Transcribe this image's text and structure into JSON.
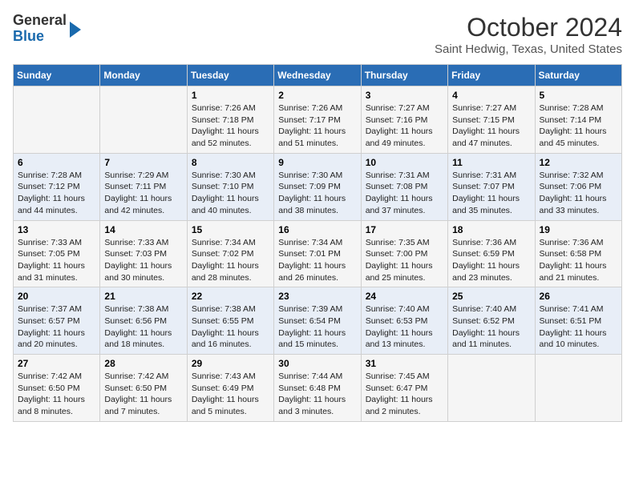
{
  "header": {
    "logo_line1": "General",
    "logo_line2": "Blue",
    "title": "October 2024",
    "subtitle": "Saint Hedwig, Texas, United States"
  },
  "days_of_week": [
    "Sunday",
    "Monday",
    "Tuesday",
    "Wednesday",
    "Thursday",
    "Friday",
    "Saturday"
  ],
  "weeks": [
    [
      {
        "num": "",
        "info": ""
      },
      {
        "num": "",
        "info": ""
      },
      {
        "num": "1",
        "info": "Sunrise: 7:26 AM\nSunset: 7:18 PM\nDaylight: 11 hours and 52 minutes."
      },
      {
        "num": "2",
        "info": "Sunrise: 7:26 AM\nSunset: 7:17 PM\nDaylight: 11 hours and 51 minutes."
      },
      {
        "num": "3",
        "info": "Sunrise: 7:27 AM\nSunset: 7:16 PM\nDaylight: 11 hours and 49 minutes."
      },
      {
        "num": "4",
        "info": "Sunrise: 7:27 AM\nSunset: 7:15 PM\nDaylight: 11 hours and 47 minutes."
      },
      {
        "num": "5",
        "info": "Sunrise: 7:28 AM\nSunset: 7:14 PM\nDaylight: 11 hours and 45 minutes."
      }
    ],
    [
      {
        "num": "6",
        "info": "Sunrise: 7:28 AM\nSunset: 7:12 PM\nDaylight: 11 hours and 44 minutes."
      },
      {
        "num": "7",
        "info": "Sunrise: 7:29 AM\nSunset: 7:11 PM\nDaylight: 11 hours and 42 minutes."
      },
      {
        "num": "8",
        "info": "Sunrise: 7:30 AM\nSunset: 7:10 PM\nDaylight: 11 hours and 40 minutes."
      },
      {
        "num": "9",
        "info": "Sunrise: 7:30 AM\nSunset: 7:09 PM\nDaylight: 11 hours and 38 minutes."
      },
      {
        "num": "10",
        "info": "Sunrise: 7:31 AM\nSunset: 7:08 PM\nDaylight: 11 hours and 37 minutes."
      },
      {
        "num": "11",
        "info": "Sunrise: 7:31 AM\nSunset: 7:07 PM\nDaylight: 11 hours and 35 minutes."
      },
      {
        "num": "12",
        "info": "Sunrise: 7:32 AM\nSunset: 7:06 PM\nDaylight: 11 hours and 33 minutes."
      }
    ],
    [
      {
        "num": "13",
        "info": "Sunrise: 7:33 AM\nSunset: 7:05 PM\nDaylight: 11 hours and 31 minutes."
      },
      {
        "num": "14",
        "info": "Sunrise: 7:33 AM\nSunset: 7:03 PM\nDaylight: 11 hours and 30 minutes."
      },
      {
        "num": "15",
        "info": "Sunrise: 7:34 AM\nSunset: 7:02 PM\nDaylight: 11 hours and 28 minutes."
      },
      {
        "num": "16",
        "info": "Sunrise: 7:34 AM\nSunset: 7:01 PM\nDaylight: 11 hours and 26 minutes."
      },
      {
        "num": "17",
        "info": "Sunrise: 7:35 AM\nSunset: 7:00 PM\nDaylight: 11 hours and 25 minutes."
      },
      {
        "num": "18",
        "info": "Sunrise: 7:36 AM\nSunset: 6:59 PM\nDaylight: 11 hours and 23 minutes."
      },
      {
        "num": "19",
        "info": "Sunrise: 7:36 AM\nSunset: 6:58 PM\nDaylight: 11 hours and 21 minutes."
      }
    ],
    [
      {
        "num": "20",
        "info": "Sunrise: 7:37 AM\nSunset: 6:57 PM\nDaylight: 11 hours and 20 minutes."
      },
      {
        "num": "21",
        "info": "Sunrise: 7:38 AM\nSunset: 6:56 PM\nDaylight: 11 hours and 18 minutes."
      },
      {
        "num": "22",
        "info": "Sunrise: 7:38 AM\nSunset: 6:55 PM\nDaylight: 11 hours and 16 minutes."
      },
      {
        "num": "23",
        "info": "Sunrise: 7:39 AM\nSunset: 6:54 PM\nDaylight: 11 hours and 15 minutes."
      },
      {
        "num": "24",
        "info": "Sunrise: 7:40 AM\nSunset: 6:53 PM\nDaylight: 11 hours and 13 minutes."
      },
      {
        "num": "25",
        "info": "Sunrise: 7:40 AM\nSunset: 6:52 PM\nDaylight: 11 hours and 11 minutes."
      },
      {
        "num": "26",
        "info": "Sunrise: 7:41 AM\nSunset: 6:51 PM\nDaylight: 11 hours and 10 minutes."
      }
    ],
    [
      {
        "num": "27",
        "info": "Sunrise: 7:42 AM\nSunset: 6:50 PM\nDaylight: 11 hours and 8 minutes."
      },
      {
        "num": "28",
        "info": "Sunrise: 7:42 AM\nSunset: 6:50 PM\nDaylight: 11 hours and 7 minutes."
      },
      {
        "num": "29",
        "info": "Sunrise: 7:43 AM\nSunset: 6:49 PM\nDaylight: 11 hours and 5 minutes."
      },
      {
        "num": "30",
        "info": "Sunrise: 7:44 AM\nSunset: 6:48 PM\nDaylight: 11 hours and 3 minutes."
      },
      {
        "num": "31",
        "info": "Sunrise: 7:45 AM\nSunset: 6:47 PM\nDaylight: 11 hours and 2 minutes."
      },
      {
        "num": "",
        "info": ""
      },
      {
        "num": "",
        "info": ""
      }
    ]
  ]
}
